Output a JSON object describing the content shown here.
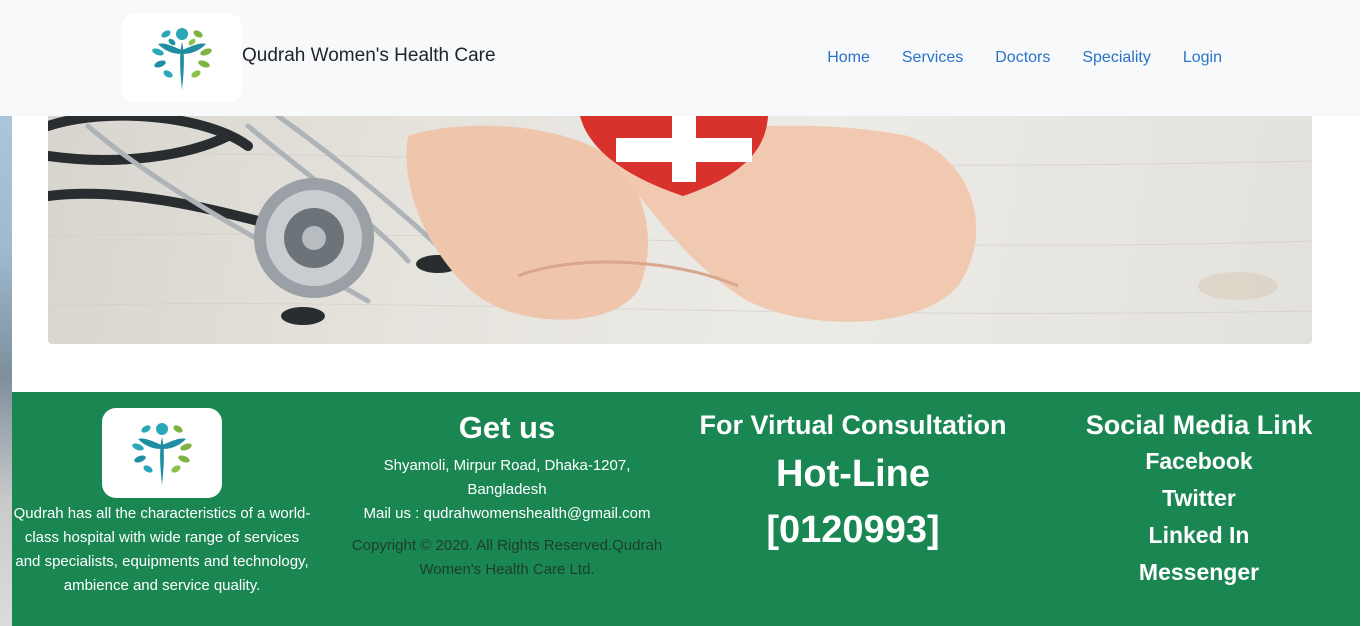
{
  "header": {
    "brand_name": "Qudrah Women's Health Care",
    "nav": [
      "Home",
      "Services",
      "Doctors",
      "Speciality",
      "Login"
    ]
  },
  "footer": {
    "about_text": "Qudrah has all the characteristics of a world-class hospital with wide range of services and specialists, equipments and technology, ambience and service quality.",
    "get_us": {
      "title": "Get us",
      "address": "Shyamoli, Mirpur Road, Dhaka-1207, Bangladesh",
      "mail": "Mail us : qudrahwomenshealth@gmail.com",
      "copyright": "Copyright © 2020. All Rights Reserved.Qudrah Women's Health Care Ltd."
    },
    "virtual": {
      "title": "For Virtual Consultation",
      "hotline_label": "Hot-Line",
      "hotline_number": "[0120993]"
    },
    "social": {
      "title": "Social Media Link",
      "links": [
        "Facebook",
        "Twitter",
        "Linked In",
        "Messenger"
      ]
    }
  },
  "colors": {
    "footer_bg": "#1a8753",
    "nav_link": "#2b73c9",
    "header_bg": "#f8f9fa"
  }
}
